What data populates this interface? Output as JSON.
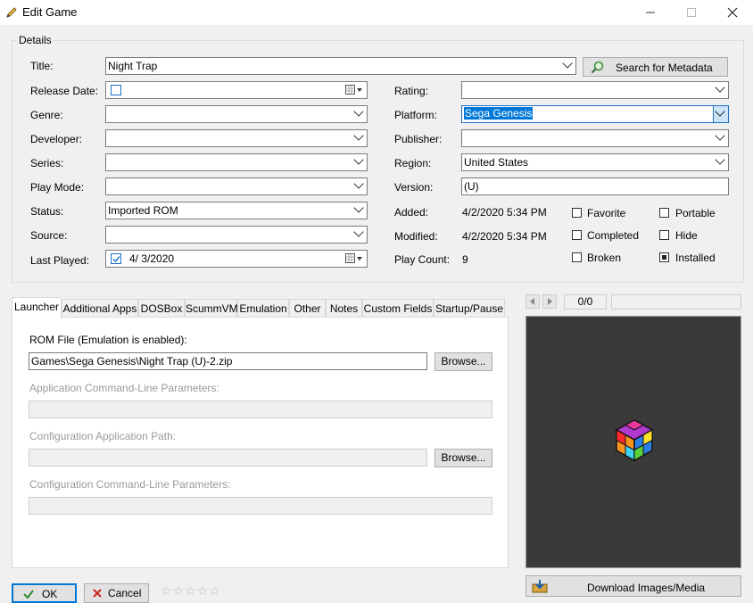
{
  "window": {
    "title": "Edit Game"
  },
  "details": {
    "group_label": "Details",
    "title_label": "Title:",
    "title_value": "Night Trap",
    "search_label": "Search for Metadata",
    "release_label": "Release Date:",
    "genre_label": "Genre:",
    "developer_label": "Developer:",
    "series_label": "Series:",
    "playmode_label": "Play Mode:",
    "status_label": "Status:",
    "status_value": "Imported ROM",
    "source_label": "Source:",
    "lastplayed_label": "Last Played:",
    "lastplayed_value": "4/  3/2020",
    "rating_label": "Rating:",
    "platform_label": "Platform:",
    "platform_value": "Sega Genesis",
    "publisher_label": "Publisher:",
    "region_label": "Region:",
    "region_value": "United States",
    "version_label": "Version:",
    "version_value": "(U)",
    "added_label": "Added:",
    "added_value": "4/2/2020 5:34 PM",
    "modified_label": "Modified:",
    "modified_value": "4/2/2020 5:34 PM",
    "playcount_label": "Play Count:",
    "playcount_value": "9",
    "flags": [
      {
        "label": "Favorite",
        "checked": false
      },
      {
        "label": "Portable",
        "checked": false
      },
      {
        "label": "Completed",
        "checked": false
      },
      {
        "label": "Hide",
        "checked": false
      },
      {
        "label": "Broken",
        "checked": false
      },
      {
        "label": "Installed",
        "checked": true
      }
    ]
  },
  "tabs": [
    "Launcher",
    "Additional Apps",
    "DOSBox",
    "ScummVM",
    "Emulation",
    "Other",
    "Notes",
    "Custom Fields",
    "Startup/Pause"
  ],
  "launcher": {
    "rom_label": "ROM File (Emulation is enabled):",
    "rom_value": "Games\\Sega Genesis\\Night Trap (U)-2.zip",
    "browse_label": "Browse...",
    "appcmd_label": "Application Command-Line Parameters:",
    "configpath_label": "Configuration Application Path:",
    "configcmd_label": "Configuration Command-Line Parameters:"
  },
  "media": {
    "counter": "0/0",
    "download_label": "Download Images/Media"
  },
  "footer": {
    "ok_label": "OK",
    "cancel_label": "Cancel"
  }
}
